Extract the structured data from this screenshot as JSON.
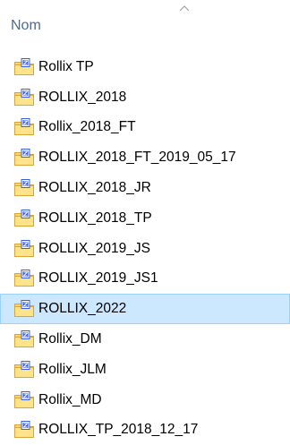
{
  "header": {
    "column_label": "Nom",
    "sort_indicator": "sort-ascending-arrow"
  },
  "colors": {
    "folder_fill": "#f7d56b",
    "folder_stroke": "#d8a53a",
    "zip_badge": "#3b5fd6",
    "selected_bg": "#cce8ff",
    "selected_border": "#99d1ff",
    "header_text": "#4c6b90"
  },
  "items": [
    {
      "label": "Rollix TP",
      "icon": "zip-folder-icon",
      "selected": false
    },
    {
      "label": "ROLLIX_2018",
      "icon": "zip-folder-icon",
      "selected": false
    },
    {
      "label": "Rollix_2018_FT",
      "icon": "zip-folder-icon",
      "selected": false
    },
    {
      "label": "ROLLIX_2018_FT_2019_05_17",
      "icon": "zip-folder-icon",
      "selected": false
    },
    {
      "label": "ROLLIX_2018_JR",
      "icon": "zip-folder-icon",
      "selected": false
    },
    {
      "label": "ROLLIX_2018_TP",
      "icon": "zip-folder-icon",
      "selected": false
    },
    {
      "label": "ROLLIX_2019_JS",
      "icon": "zip-folder-icon",
      "selected": false
    },
    {
      "label": "ROLLIX_2019_JS1",
      "icon": "zip-folder-icon",
      "selected": false
    },
    {
      "label": "ROLLIX_2022",
      "icon": "zip-folder-icon",
      "selected": true
    },
    {
      "label": "Rollix_DM",
      "icon": "zip-folder-icon",
      "selected": false
    },
    {
      "label": "Rollix_JLM",
      "icon": "zip-folder-icon",
      "selected": false
    },
    {
      "label": "Rollix_MD",
      "icon": "zip-folder-icon",
      "selected": false
    },
    {
      "label": "ROLLIX_TP_2018_12_17",
      "icon": "zip-folder-icon",
      "selected": false
    }
  ]
}
